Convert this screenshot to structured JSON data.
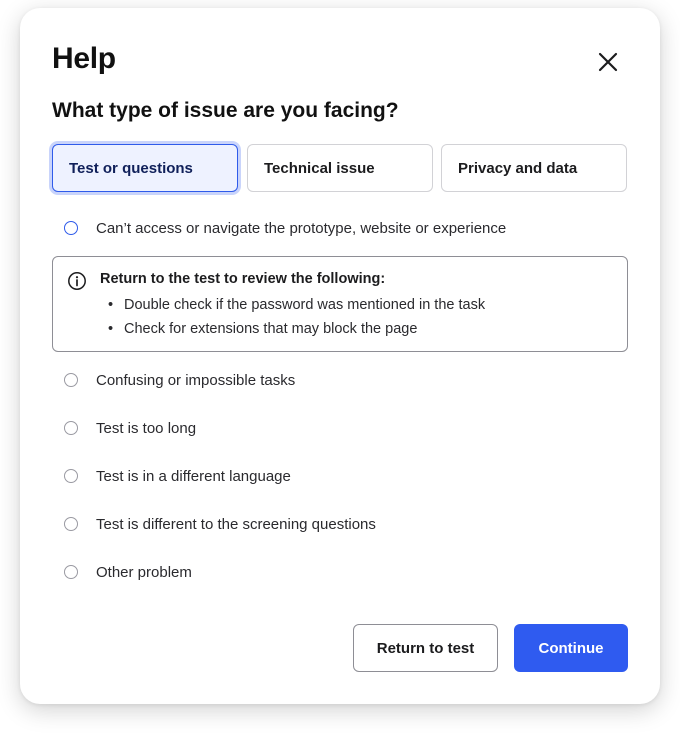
{
  "dialog": {
    "title": "Help",
    "close_icon": "close-icon",
    "question": "What type of issue are you facing?"
  },
  "tabs": [
    {
      "label": "Test or questions",
      "active": true
    },
    {
      "label": "Technical issue",
      "active": false
    },
    {
      "label": "Privacy and data",
      "active": false
    }
  ],
  "options": [
    {
      "label": "Can’t access or navigate the prototype, website or experience",
      "highlighted": true
    },
    {
      "label": "Confusing or impossible tasks"
    },
    {
      "label": "Test is too long"
    },
    {
      "label": "Test is in a different language"
    },
    {
      "label": "Test is different to the screening questions"
    },
    {
      "label": "Other problem"
    }
  ],
  "info": {
    "icon": "info-icon",
    "title": "Return to the test to review the following:",
    "items": [
      "Double check if the password was mentioned in the task",
      "Check for extensions that may block the page"
    ]
  },
  "footer": {
    "secondary_label": "Return to test",
    "primary_label": "Continue"
  },
  "colors": {
    "accent": "#2f5bf0",
    "active_tab_bg": "#eef2ff",
    "border": "#d2d2d6"
  }
}
